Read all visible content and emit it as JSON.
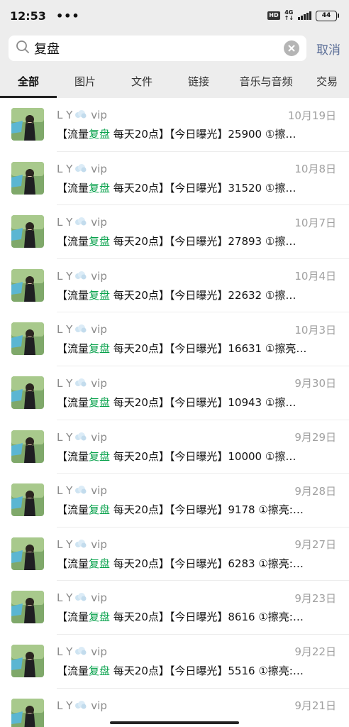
{
  "status_bar": {
    "time": "12:53",
    "dots": "•••",
    "hd_label": "HD",
    "network": "4G",
    "battery": "44"
  },
  "search": {
    "query": "复盘",
    "cancel_label": "取消"
  },
  "tabs": [
    {
      "label": "全部",
      "active": true
    },
    {
      "label": "图片",
      "active": false
    },
    {
      "label": "文件",
      "active": false
    },
    {
      "label": "链接",
      "active": false
    },
    {
      "label": "音乐与音频",
      "active": false
    },
    {
      "label": "交易",
      "active": false
    }
  ],
  "results": [
    {
      "sender": "L Y",
      "sender_suffix": "vip",
      "date": "10月19日",
      "prefix": "【流量",
      "highlight": "复盘",
      "suffix": " 每天20点】【今日曝光】25900 ①擦…"
    },
    {
      "sender": "L Y",
      "sender_suffix": "vip",
      "date": "10月8日",
      "prefix": "【流量",
      "highlight": "复盘",
      "suffix": " 每天20点】【今日曝光】31520 ①擦…"
    },
    {
      "sender": "L Y",
      "sender_suffix": "vip",
      "date": "10月7日",
      "prefix": "【流量",
      "highlight": "复盘",
      "suffix": " 每天20点】【今日曝光】27893 ①擦…"
    },
    {
      "sender": "L Y",
      "sender_suffix": "vip",
      "date": "10月4日",
      "prefix": "【流量",
      "highlight": "复盘",
      "suffix": " 每天20点】【今日曝光】22632 ①擦…"
    },
    {
      "sender": "L Y",
      "sender_suffix": "vip",
      "date": "10月3日",
      "prefix": "【流量",
      "highlight": "复盘",
      "suffix": " 每天20点】【今日曝光】16631 ①擦亮…"
    },
    {
      "sender": "L Y",
      "sender_suffix": "vip",
      "date": "9月30日",
      "prefix": "【流量",
      "highlight": "复盘",
      "suffix": " 每天20点】【今日曝光】10943 ①擦…"
    },
    {
      "sender": "L Y",
      "sender_suffix": "vip",
      "date": "9月29日",
      "prefix": "【流量",
      "highlight": "复盘",
      "suffix": " 每天20点】【今日曝光】10000 ①擦…"
    },
    {
      "sender": "L Y",
      "sender_suffix": "vip",
      "date": "9月28日",
      "prefix": "【流量",
      "highlight": "复盘",
      "suffix": " 每天20点】【今日曝光】9178 ①擦亮:…"
    },
    {
      "sender": "L Y",
      "sender_suffix": "vip",
      "date": "9月27日",
      "prefix": "【流量",
      "highlight": "复盘",
      "suffix": " 每天20点】【今日曝光】6283 ①擦亮:…"
    },
    {
      "sender": "L Y",
      "sender_suffix": "vip",
      "date": "9月23日",
      "prefix": "【流量",
      "highlight": "复盘",
      "suffix": " 每天20点】【今日曝光】8616 ①擦亮:…"
    },
    {
      "sender": "L Y",
      "sender_suffix": "vip",
      "date": "9月22日",
      "prefix": "【流量",
      "highlight": "复盘",
      "suffix": " 每天20点】【今日曝光】5516 ①擦亮:…"
    },
    {
      "sender": "L Y",
      "sender_suffix": "vip",
      "date": "9月21日",
      "prefix": "",
      "highlight": "",
      "suffix": ""
    }
  ],
  "colors": {
    "highlight": "#07a14b",
    "link": "#576b95",
    "background_top": "#ededed"
  }
}
